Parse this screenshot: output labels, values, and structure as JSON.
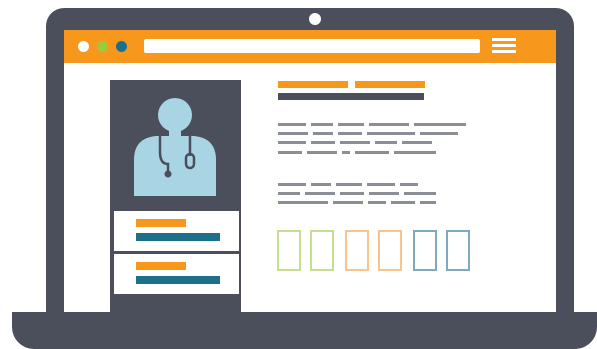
{
  "colors": {
    "frame": "#4a4f5b",
    "accent": "#f7981d",
    "green": "#9acb3c",
    "teal": "#1d6f8a",
    "avatar": "#a9d4e4",
    "text_lines": "#8a8e96"
  },
  "browser": {
    "dots": [
      "white",
      "green",
      "teal"
    ],
    "menu_icon": "hamburger-menu-icon"
  },
  "profile": {
    "avatar_icon": "doctor-with-stethoscope-icon",
    "info_boxes": 2
  },
  "swatches": [
    {
      "color": "#c6df8e"
    },
    {
      "color": "#c6df8e"
    },
    {
      "color": "#f9c48a"
    },
    {
      "color": "#f9c48a"
    },
    {
      "color": "#7fa9bd"
    },
    {
      "color": "#7fa9bd"
    }
  ]
}
